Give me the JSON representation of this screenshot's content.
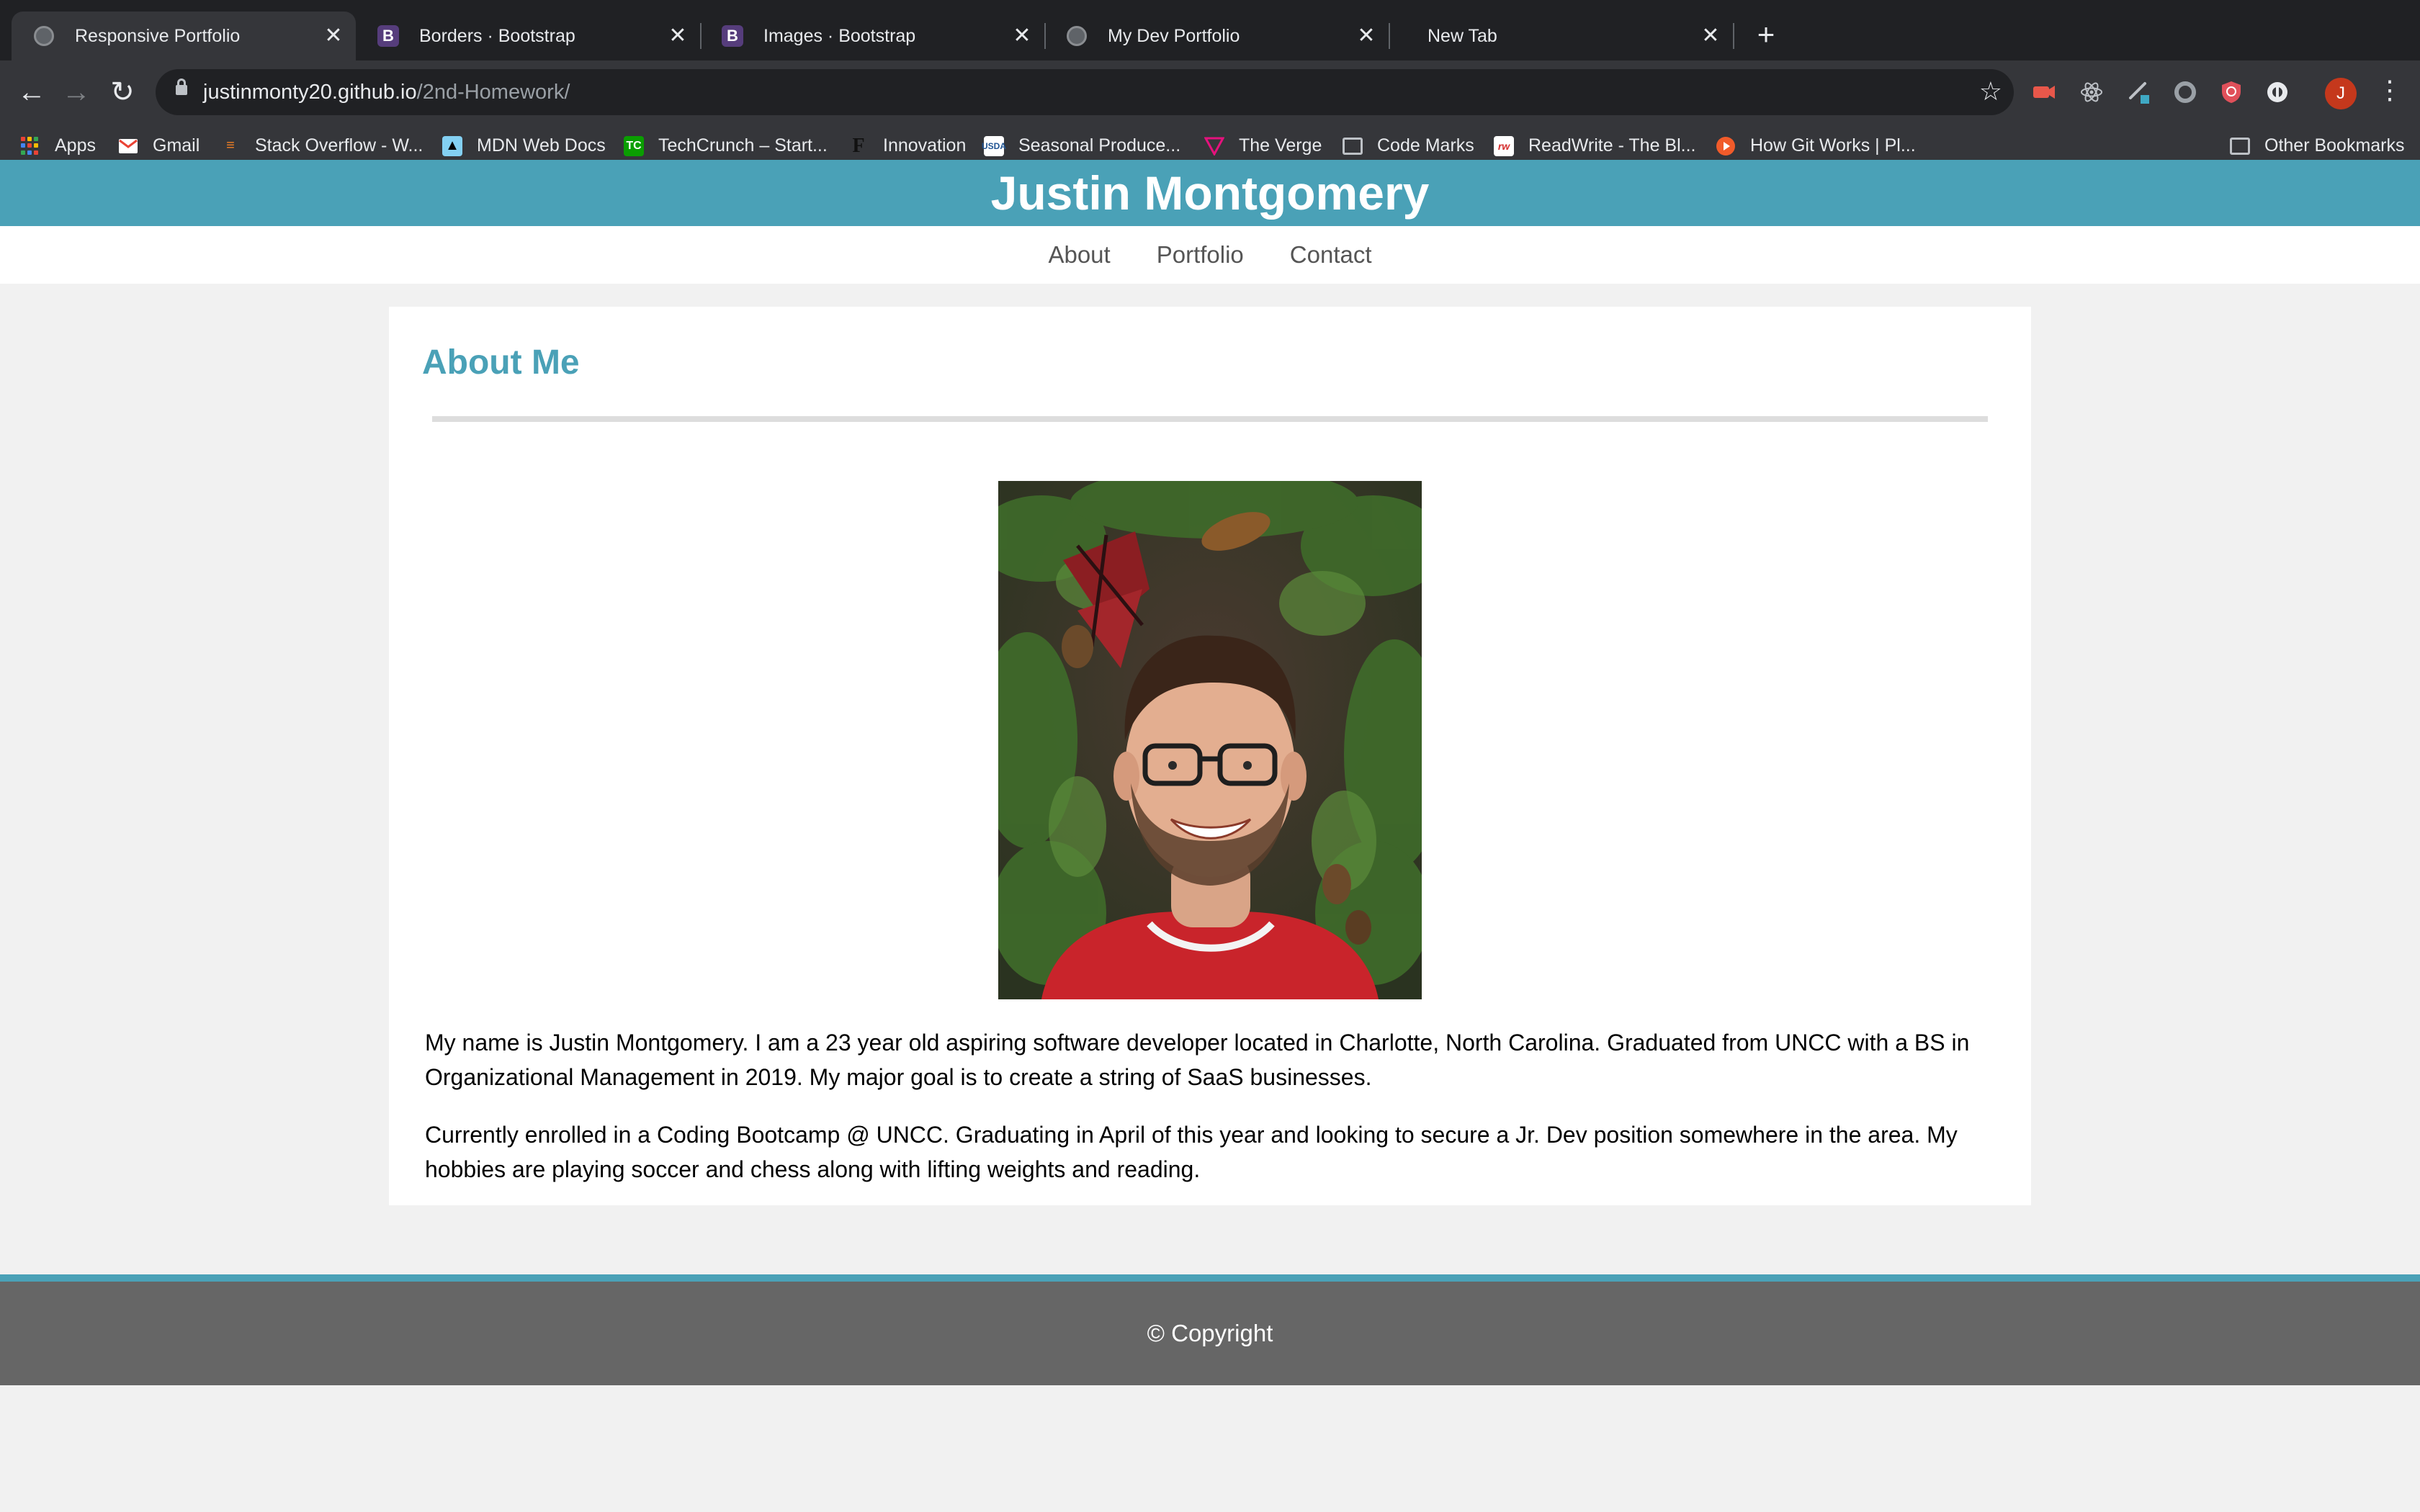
{
  "browser": {
    "tabs": [
      {
        "title": "Responsive Portfolio",
        "icon": "globe-icon",
        "active": true
      },
      {
        "title": "Borders · Bootstrap",
        "icon": "bootstrap-icon",
        "active": false
      },
      {
        "title": "Images · Bootstrap",
        "icon": "bootstrap-icon",
        "active": false
      },
      {
        "title": "My Dev Portfolio",
        "icon": "globe-icon",
        "active": false
      },
      {
        "title": "New Tab",
        "icon": "",
        "active": false
      }
    ],
    "new_tab": "+",
    "close_glyph": "✕",
    "url_host": "justinmonty20.github.io",
    "url_path": "/2nd-Homework/",
    "profile_initial": "J",
    "bookmarks": [
      {
        "label": "Apps",
        "icon": "apps-grid-icon"
      },
      {
        "label": "Gmail",
        "icon": "gmail-icon"
      },
      {
        "label": "Stack Overflow - W...",
        "icon": "stackoverflow-icon"
      },
      {
        "label": "MDN Web Docs",
        "icon": "mdn-icon"
      },
      {
        "label": "TechCrunch – Start...",
        "icon": "techcrunch-icon"
      },
      {
        "label": "Innovation",
        "icon": "innovation-icon"
      },
      {
        "label": "Seasonal Produce...",
        "icon": "usda-icon"
      },
      {
        "label": "The Verge",
        "icon": "verge-icon"
      },
      {
        "label": "Code Marks",
        "icon": "folder-icon"
      },
      {
        "label": "ReadWrite - The Bl...",
        "icon": "readwrite-icon"
      },
      {
        "label": "How Git Works | Pl...",
        "icon": "pluralsight-icon"
      }
    ],
    "other_bookmarks": "Other Bookmarks"
  },
  "site": {
    "title": "Justin Montgomery",
    "nav": [
      "About",
      "Portfolio",
      "Contact"
    ],
    "section_title": "About Me",
    "paragraphs": [
      "My name is Justin Montgomery. I am a 23 year old aspiring software developer located in Charlotte, North Carolina. Graduated from UNCC with a BS in Organizational Management in 2019. My major goal is to create a string of SaaS businesses.",
      "Currently enrolled in a Coding Bootcamp @ UNCC. Graduating in April of this year and looking to secure a Jr. Dev position somewhere in the area. My hobbies are playing soccer and chess along with lifting weights and reading."
    ],
    "footer": "© Copyright"
  },
  "colors": {
    "brand": "#4aa1b7",
    "footer": "#666666",
    "page_bg": "#f1f1f1"
  }
}
